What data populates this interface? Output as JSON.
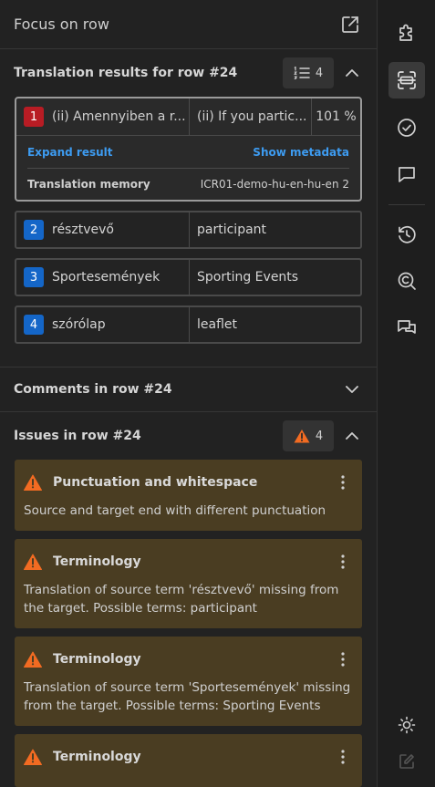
{
  "header": {
    "title": "Focus on row"
  },
  "translation_results": {
    "title": "Translation results for row #24",
    "count": "4",
    "items": [
      {
        "index": "1",
        "source": "(ii) Amennyiben a r...",
        "target": "(ii) If you partic...",
        "match": "101 %"
      },
      {
        "index": "2",
        "source": "résztvevő",
        "target": "participant"
      },
      {
        "index": "3",
        "source": "Sportesemények",
        "target": "Sporting Events"
      },
      {
        "index": "4",
        "source": "szórólap",
        "target": "leaflet"
      }
    ],
    "expand_label": "Expand result",
    "metadata_label": "Show metadata",
    "tm_label": "Translation memory",
    "tm_value": "ICR01-demo-hu-en-hu-en 2"
  },
  "comments": {
    "title": "Comments in row #24"
  },
  "issues": {
    "title": "Issues in row #24",
    "count": "4",
    "items": [
      {
        "title": "Punctuation and whitespace",
        "description": "Source and target end with different punctuation"
      },
      {
        "title": "Terminology",
        "description": "Translation of source term 'résztvevő' missing from the target. Possible terms: participant"
      },
      {
        "title": "Terminology",
        "description": "Translation of source term 'Sportesemények' missing from the target. Possible terms: Sporting Events"
      },
      {
        "title": "Terminology",
        "description": ""
      }
    ]
  },
  "colors": {
    "warning": "#f26b22",
    "issue_bg": "#4a3d22",
    "link": "#3d9bf0",
    "index_red": "#b81c24",
    "index_blue": "#1466c8"
  },
  "rail_icons": [
    "puzzle-icon",
    "row-focus-icon",
    "check-circle-icon",
    "comment-icon",
    "history-icon",
    "search-check-icon",
    "conversation-icon",
    "sun-icon",
    "edit-icon"
  ]
}
